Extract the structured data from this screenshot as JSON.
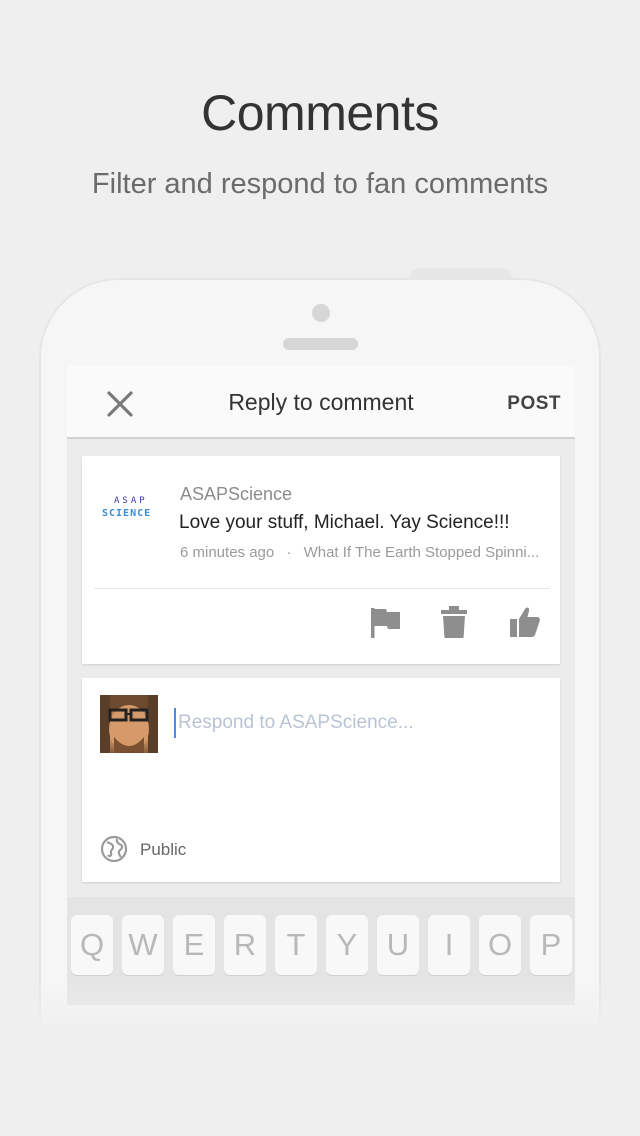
{
  "promo": {
    "title": "Comments",
    "subtitle": "Filter and respond to fan comments"
  },
  "header": {
    "close_icon": "close-icon",
    "title": "Reply to comment",
    "post_label": "POST"
  },
  "comment": {
    "author": "ASAPScience",
    "logo_text_top": "ASAP",
    "logo_text_bottom": "SCIENCE",
    "text": "Love your stuff, Michael. Yay Science!!!",
    "time": "6 minutes ago",
    "separator": "·",
    "video_title": "What If The Earth Stopped Spinni...",
    "actions": [
      "flag-icon",
      "trash-icon",
      "thumbs-up-icon"
    ]
  },
  "reply": {
    "placeholder": "Respond to ASAPScience...",
    "visibility_label": "Public",
    "visibility_icon": "globe-icon"
  },
  "keyboard": {
    "row1": [
      "Q",
      "W",
      "E",
      "R",
      "T",
      "Y",
      "U",
      "I",
      "O",
      "P"
    ]
  },
  "colors": {
    "background": "#efefef",
    "cursor": "#4a8bdc",
    "icon_gray": "#8e8e8e"
  }
}
